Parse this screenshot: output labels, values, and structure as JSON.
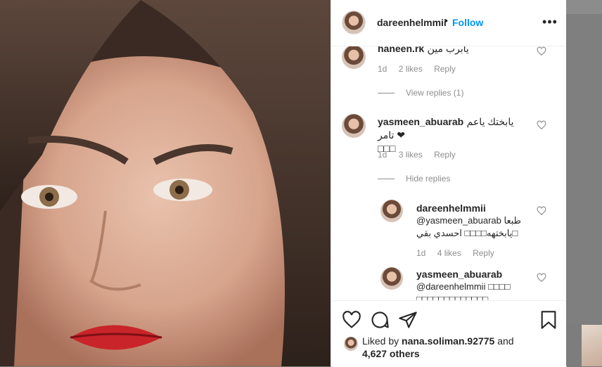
{
  "post": {
    "username": "dareenhelmmii",
    "dot": "•",
    "follow_label": "Follow",
    "more_label": "•••"
  },
  "comments": [
    {
      "username": "haneen.rk",
      "text": "يابرب مين",
      "time": "1d",
      "likes": "2 likes",
      "reply_label": "Reply",
      "replies_toggle": "View replies (1)"
    },
    {
      "username": "yasmeen_abuarab",
      "text": "يابختك ياعم تامر ❤",
      "text_line2": "□□□",
      "time": "1d",
      "likes": "3 likes",
      "reply_label": "Reply",
      "replies_toggle": "Hide replies"
    }
  ],
  "replies": [
    {
      "username": "dareenhelmmii",
      "text": "@yasmeen_abuarab طبعا",
      "text_line2": "يابختهه□□□□ احسدي بقي□",
      "time": "1d",
      "likes": "4 likes",
      "reply_label": "Reply"
    },
    {
      "username": "yasmeen_abuarab",
      "text": "@dareenhelmmii □□□□",
      "text_line2": "□□□□□□□□□□□□□"
    }
  ],
  "liked_by": {
    "prefix": "Liked by",
    "user": "nana.soliman.92775",
    "and": "and",
    "others": "4,627 others"
  },
  "icons": {
    "like": "heart-icon",
    "comment": "comment-icon",
    "share": "share-icon",
    "save": "bookmark-icon",
    "comment_like": "heart-icon"
  },
  "colors": {
    "follow": "#0095f6",
    "text": "#262626",
    "muted": "#8e8e8e"
  }
}
